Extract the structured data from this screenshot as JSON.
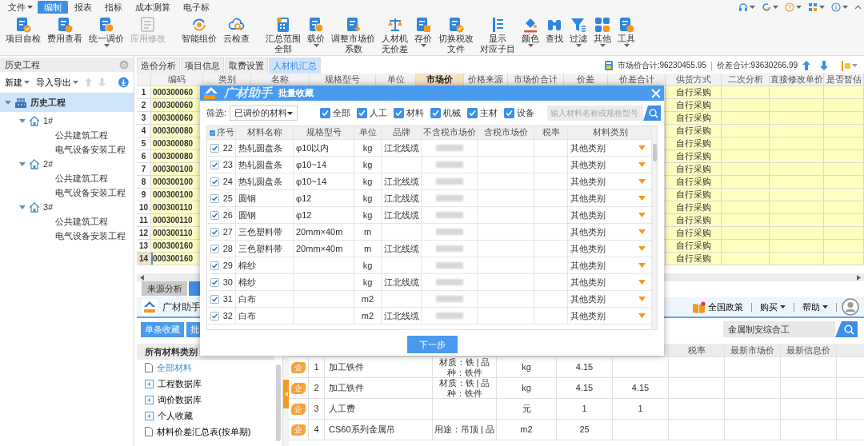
{
  "menu": {
    "file": "文件",
    "tabs": [
      {
        "label": "编制",
        "selected": true
      },
      {
        "label": "报表",
        "selected": false
      },
      {
        "label": "指标",
        "selected": false
      },
      {
        "label": "成本测算",
        "selected": false
      },
      {
        "label": "电子标",
        "selected": false
      }
    ]
  },
  "toolbar": [
    [
      {
        "lines": [
          "项目自检"
        ],
        "caret": false,
        "disabled": false
      },
      {
        "lines": [
          "费用查看"
        ],
        "caret": false,
        "disabled": false
      },
      {
        "lines": [
          "统一调价"
        ],
        "caret": true,
        "disabled": false
      },
      {
        "lines": [
          "应用修改"
        ],
        "caret": false,
        "disabled": true
      }
    ],
    [
      {
        "lines": [
          "智能组价"
        ],
        "caret": false,
        "disabled": false
      },
      {
        "lines": [
          "云检查"
        ],
        "caret": false,
        "disabled": false
      }
    ],
    [
      {
        "lines": [
          "汇总范围",
          "全部"
        ],
        "caret": false,
        "disabled": false
      },
      {
        "lines": [
          "载价"
        ],
        "caret": true,
        "disabled": false
      },
      {
        "lines": [
          "调整市场价",
          "系数"
        ],
        "caret": false,
        "disabled": false
      },
      {
        "lines": [
          "人材机",
          "无价差"
        ],
        "caret": false,
        "disabled": false
      },
      {
        "lines": [
          "存价"
        ],
        "caret": true,
        "disabled": false
      },
      {
        "lines": [
          "切换税改",
          "文件"
        ],
        "caret": false,
        "disabled": false
      },
      {
        "lines": [
          "显示",
          "对应子目"
        ],
        "caret": false,
        "disabled": false
      },
      {
        "lines": [
          "颜色"
        ],
        "caret": true,
        "disabled": false
      },
      {
        "lines": [
          "查找"
        ],
        "caret": false,
        "disabled": false
      },
      {
        "lines": [
          "过滤"
        ],
        "caret": true,
        "disabled": false
      },
      {
        "lines": [
          "其他"
        ],
        "caret": true,
        "disabled": false
      },
      {
        "lines": [
          "工具"
        ],
        "caret": true,
        "disabled": false
      }
    ]
  ],
  "history": {
    "title": "历史工程",
    "actions": [
      {
        "label": "新建"
      },
      {
        "label": "导入导出"
      }
    ],
    "tree": [
      {
        "label": "历史工程",
        "expanded": true,
        "selected": true,
        "children": [
          {
            "label": "1#",
            "expanded": true,
            "selected": false,
            "children": [
              {
                "label": "公共建筑工程",
                "selected": false
              },
              {
                "label": "电气设备安装工程",
                "selected": false
              }
            ]
          },
          {
            "label": "2#",
            "expanded": true,
            "selected": false,
            "children": [
              {
                "label": "公共建筑工程",
                "selected": false
              },
              {
                "label": "电气设备安装工程",
                "selected": false
              }
            ]
          },
          {
            "label": "3#",
            "expanded": true,
            "selected": false,
            "children": [
              {
                "label": "公共建筑工程",
                "selected": false
              },
              {
                "label": "电气设备安装工程",
                "selected": false
              }
            ]
          }
        ]
      }
    ]
  },
  "views": {
    "tabs": [
      {
        "label": "造价分析",
        "selected": false
      },
      {
        "label": "项目信息",
        "selected": false
      },
      {
        "label": "取费设置",
        "selected": false
      },
      {
        "label": "人材机汇总",
        "selected": true
      }
    ],
    "market_total": "市场价合计:96230455.95",
    "diff_total": "价差合计:93630266.99"
  },
  "grid": {
    "columns": [
      {
        "label": "编码",
        "highlighted": false
      },
      {
        "label": "类别",
        "highlighted": false
      },
      {
        "label": "名称",
        "highlighted": false
      },
      {
        "label": "规格型号",
        "highlighted": false
      },
      {
        "label": "单位",
        "highlighted": false
      },
      {
        "label": "市场价",
        "highlighted": true
      },
      {
        "label": "价格来源",
        "highlighted": false
      },
      {
        "label": "市场价合计",
        "highlighted": false
      },
      {
        "label": "价差",
        "highlighted": false
      },
      {
        "label": "价差合计",
        "highlighted": false
      },
      {
        "label": "供货方式",
        "highlighted": false
      },
      {
        "label": "二次分析",
        "highlighted": false
      },
      {
        "label": "直接修改单价",
        "highlighted": false
      },
      {
        "label": "是否暂估",
        "highlighted": false
      }
    ],
    "rows": [
      {
        "no": "1",
        "code": "000300060",
        "supply": "自行采购",
        "selected": false
      },
      {
        "no": "2",
        "code": "000300060",
        "supply": "自行采购",
        "selected": false
      },
      {
        "no": "3",
        "code": "000300060",
        "supply": "自行采购",
        "selected": false
      },
      {
        "no": "4",
        "code": "000300080",
        "supply": "自行采购",
        "selected": false
      },
      {
        "no": "5",
        "code": "000300080",
        "supply": "自行采购",
        "selected": false
      },
      {
        "no": "6",
        "code": "000300080",
        "supply": "自行采购",
        "selected": false
      },
      {
        "no": "7",
        "code": "000300100",
        "supply": "自行采购",
        "selected": false
      },
      {
        "no": "8",
        "code": "000300100",
        "supply": "自行采购",
        "selected": false
      },
      {
        "no": "9",
        "code": "000300100",
        "supply": "自行采购",
        "selected": false
      },
      {
        "no": "10",
        "code": "000300110",
        "supply": "自行采购",
        "selected": false
      },
      {
        "no": "11",
        "code": "000300110",
        "supply": "自行采购",
        "selected": false
      },
      {
        "no": "12",
        "code": "000300110",
        "supply": "自行采购",
        "selected": false
      },
      {
        "no": "13",
        "code": "000300160",
        "supply": "自行采购",
        "selected": false
      },
      {
        "no": "14",
        "code": "000300160",
        "supply": "自行采购",
        "selected": true
      }
    ]
  },
  "assistant": {
    "tabs": [
      {
        "label": "来源分析",
        "selected": false
      },
      {
        "selected": true
      }
    ],
    "title": "广材助手",
    "links": [
      {
        "label": "全国政策",
        "kind": "policy"
      },
      {
        "label": "购买",
        "kind": "menu"
      },
      {
        "label": "帮助",
        "kind": "menu"
      }
    ],
    "buttons": [
      "单条收藏",
      "批"
    ],
    "search_value": "金属制安综合工",
    "categories_title": "所有材料类别",
    "categories": [
      {
        "label": "全部材料",
        "kind": "page",
        "selected": true
      },
      {
        "label": "工程数据库",
        "kind": "folder",
        "selected": false
      },
      {
        "label": "询价数据库",
        "kind": "folder",
        "selected": false
      },
      {
        "label": "个人收藏",
        "kind": "folder",
        "selected": false
      },
      {
        "label": "材料价差汇总表(按单期)",
        "kind": "page",
        "selected": false
      }
    ],
    "results": {
      "columns": [
        "税率",
        "最新市场价",
        "最新信息价"
      ],
      "rows": [
        {
          "badge": "企",
          "no": "1",
          "name": "加工铁件",
          "spec": "材质：铁 | 品种：铁件",
          "unit": "kg",
          "price": "4.15"
        },
        {
          "badge": "企",
          "no": "2",
          "name": "加工铁件",
          "spec": "材质：铁 | 品种：铁件",
          "unit": "kg",
          "price": "4.15",
          "price_2": "4.15"
        },
        {
          "badge": "企",
          "no": "3",
          "name": "人工费",
          "unit": "元",
          "price": "1",
          "price_2": "1"
        },
        {
          "badge": "企",
          "no": "4",
          "name": "CS60系列金属吊",
          "spec": "用途：吊顶 | 品",
          "unit": "m2",
          "price": "25"
        }
      ]
    }
  },
  "dialog": {
    "brand": "广材助手",
    "title": "批量收藏",
    "filter_label": "筛选:",
    "filter_value": "已调价的材料",
    "types": [
      {
        "label": "全部",
        "checked": true
      },
      {
        "label": "人工",
        "checked": true
      },
      {
        "label": "材料",
        "checked": true
      },
      {
        "label": "机械",
        "checked": true
      },
      {
        "label": "主材",
        "checked": true
      },
      {
        "label": "设备",
        "checked": true
      }
    ],
    "search_placeholder": "输入材料名称或规格型号",
    "all_checked": true,
    "columns": [
      "序号",
      "材料名称",
      "规格型号",
      "单位",
      "品牌",
      "不含税市场价",
      "含税市场价",
      "税率",
      "材料类别"
    ],
    "rows": [
      {
        "checked": true,
        "no": "22",
        "name": "热轧圆盘条",
        "spec": "φ10以内",
        "unit": "kg",
        "brand": "江北线缆",
        "category": "其他类别"
      },
      {
        "checked": true,
        "no": "23",
        "name": "热轧圆盘条",
        "spec": "φ10~14",
        "unit": "kg",
        "category": "其他类别"
      },
      {
        "checked": true,
        "no": "24",
        "name": "热轧圆盘条",
        "spec": "φ10~14",
        "unit": "kg",
        "brand": "江北线缆",
        "category": "其他类别"
      },
      {
        "checked": true,
        "no": "25",
        "name": "圆钢",
        "spec": "φ12",
        "unit": "kg",
        "brand": "江北线缆",
        "category": "其他类别"
      },
      {
        "checked": true,
        "no": "26",
        "name": "圆钢",
        "spec": "φ12",
        "unit": "kg",
        "brand": "江北线缆",
        "category": "其他类别"
      },
      {
        "checked": true,
        "no": "27",
        "name": "三色塑料带",
        "spec": "20mm×40m",
        "unit": "m",
        "category": "其他类别"
      },
      {
        "checked": true,
        "no": "28",
        "name": "三色塑料带",
        "spec": "20mm×40m",
        "unit": "m",
        "brand": "江北线缆",
        "category": "其他类别"
      },
      {
        "checked": true,
        "no": "29",
        "name": "棉纱",
        "unit": "kg",
        "category": "其他类别"
      },
      {
        "checked": true,
        "no": "30",
        "name": "棉纱",
        "unit": "kg",
        "brand": "江北线缆",
        "category": "其他类别"
      },
      {
        "checked": true,
        "no": "31",
        "name": "白布",
        "unit": "m2",
        "category": "其他类别"
      },
      {
        "checked": true,
        "no": "32",
        "name": "白布",
        "unit": "m2",
        "brand": "江北线缆",
        "category": "其他类别"
      }
    ],
    "next_button": "下一步"
  }
}
